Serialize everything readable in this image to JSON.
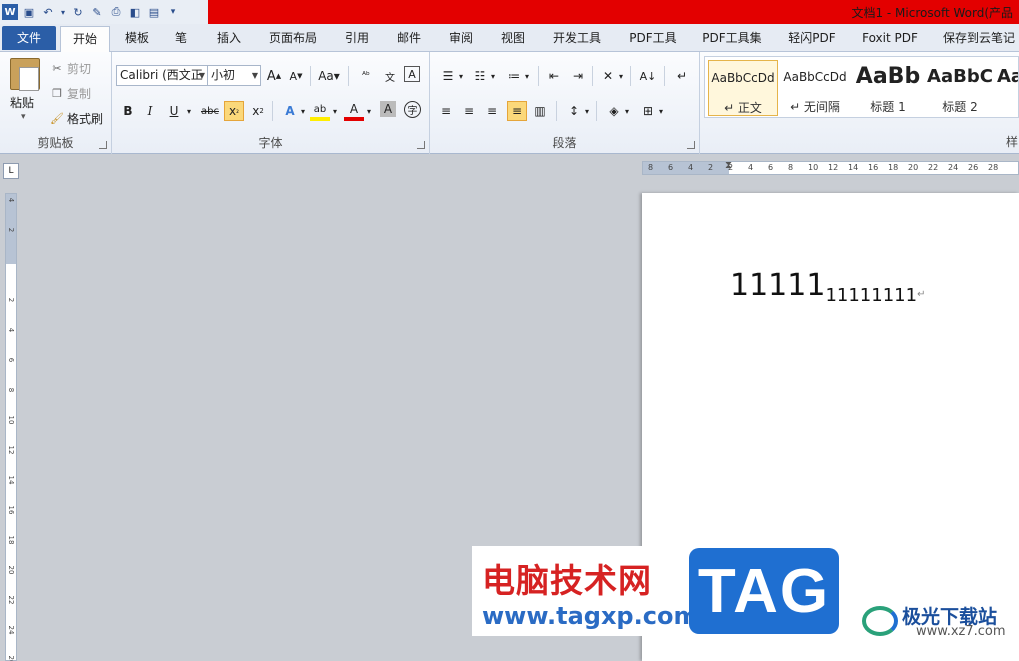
{
  "titlebar": {
    "title": "文档1 - Microsoft Word(产品"
  },
  "tabs": [
    {
      "label": "文件"
    },
    {
      "label": "开始"
    },
    {
      "label": "模板"
    },
    {
      "label": "笔"
    },
    {
      "label": "插入"
    },
    {
      "label": "页面布局"
    },
    {
      "label": "引用"
    },
    {
      "label": "邮件"
    },
    {
      "label": "审阅"
    },
    {
      "label": "视图"
    },
    {
      "label": "开发工具"
    },
    {
      "label": "PDF工具"
    },
    {
      "label": "PDF工具集"
    },
    {
      "label": "轻闪PDF"
    },
    {
      "label": "Foxit PDF"
    },
    {
      "label": "保存到云笔记"
    }
  ],
  "clipboard": {
    "paste": "粘贴",
    "cut": "剪切",
    "copy": "复制",
    "format_painter": "格式刷",
    "group_label": "剪贴板"
  },
  "font": {
    "font_name": "Calibri (西文正",
    "font_size": "小初",
    "group_label": "字体"
  },
  "paragraph": {
    "group_label": "段落"
  },
  "styles": {
    "items": [
      {
        "sample": "AaBbCcDd",
        "name": "↵ 正文"
      },
      {
        "sample": "AaBbCcDd",
        "name": "↵ 无间隔"
      },
      {
        "sample": "AaBb",
        "name": "标题 1"
      },
      {
        "sample": "AaBbC",
        "name": "标题 2"
      },
      {
        "sample": "Aa",
        "name": ""
      }
    ],
    "group_label": "样"
  },
  "document": {
    "text_normal": "11111",
    "text_subscript": "11111111",
    "paragraph_mark": "↵"
  },
  "ruler": {
    "h_numbers": [
      "8",
      "6",
      "4",
      "2",
      "2",
      "4",
      "6",
      "8",
      "10",
      "12",
      "14",
      "16",
      "18",
      "20",
      "22",
      "24",
      "26",
      "28"
    ],
    "v_numbers": [
      "4",
      "2",
      "2",
      "4",
      "6",
      "8",
      "10",
      "12",
      "14",
      "16",
      "18",
      "20",
      "22",
      "24",
      "26"
    ]
  },
  "watermark": {
    "site_cn": "电脑技术网",
    "site_url": "www.tagxp.com",
    "tag": "TAG",
    "brand_cn": "极光下载站",
    "brand_url": "www.xz7.com"
  }
}
